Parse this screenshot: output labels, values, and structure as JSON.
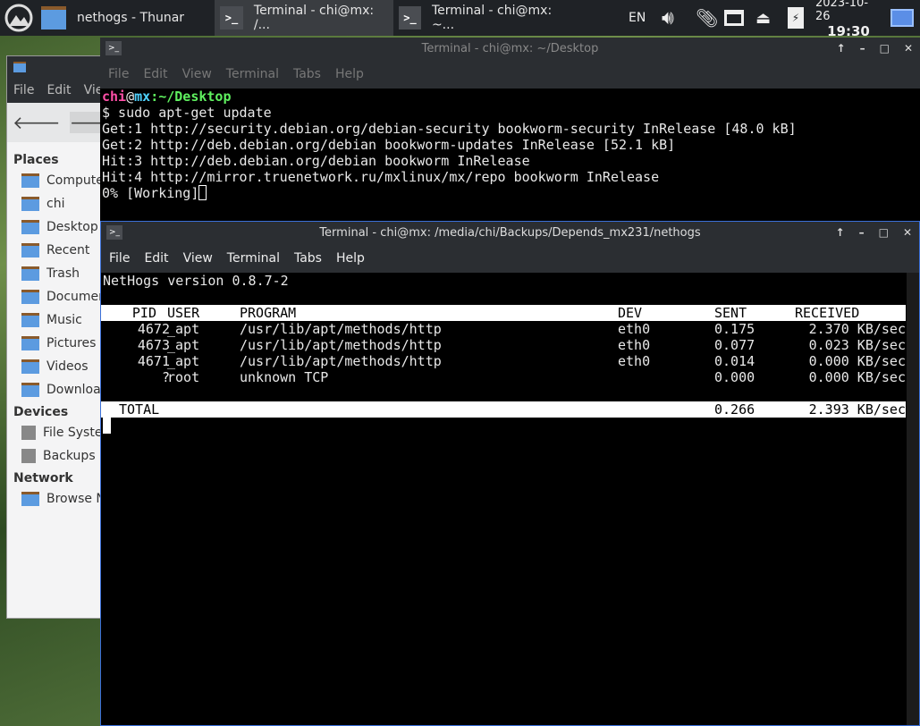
{
  "taskbar": {
    "windows": [
      {
        "label": "nethogs - Thunar"
      },
      {
        "label": "Terminal - chi@mx: /..."
      },
      {
        "label": "Terminal - chi@mx: ~..."
      }
    ],
    "lang": "EN",
    "date": "2023-10-26",
    "time": "19:30"
  },
  "thunar": {
    "menu": [
      "File",
      "Edit",
      "View"
    ],
    "places_header": "Places",
    "places": [
      "Computer",
      "chi",
      "Desktop",
      "Recent",
      "Trash",
      "Documents",
      "Music",
      "Pictures",
      "Videos",
      "Downloads"
    ],
    "devices_header": "Devices",
    "devices": [
      "File System",
      "Backups"
    ],
    "network_header": "Network",
    "network": [
      "Browse Network"
    ]
  },
  "term1": {
    "title": "Terminal - chi@mx: ~/Desktop",
    "menu": [
      "File",
      "Edit",
      "View",
      "Terminal",
      "Tabs",
      "Help"
    ],
    "prompt_user": "chi",
    "prompt_at": "@",
    "prompt_host": "mx",
    "prompt_path": ":~/Desktop",
    "command": "$ sudo apt-get update",
    "lines": [
      "Get:1 http://security.debian.org/debian-security bookworm-security InRelease [48.0 kB]",
      "Get:2 http://deb.debian.org/debian bookworm-updates InRelease [52.1 kB]",
      "Hit:3 http://deb.debian.org/debian bookworm InRelease",
      "Hit:4 http://mirror.truenetwork.ru/mxlinux/mx/repo bookworm InRelease",
      "0% [Working]"
    ]
  },
  "term2": {
    "title": "Terminal - chi@mx: /media/chi/Backups/Depends_mx231/nethogs",
    "menu": [
      "File",
      "Edit",
      "View",
      "Terminal",
      "Tabs",
      "Help"
    ],
    "version": "NetHogs version 0.8.7-2",
    "headers": {
      "pid": "PID",
      "user": "USER",
      "program": "PROGRAM",
      "dev": "DEV",
      "sent": "SENT",
      "received": "RECEIVED"
    },
    "rows": [
      {
        "pid": "4672",
        "user": "_apt",
        "program": "/usr/lib/apt/methods/http",
        "dev": "eth0",
        "sent": "0.175",
        "received": "2.370 KB/sec"
      },
      {
        "pid": "4673",
        "user": "_apt",
        "program": "/usr/lib/apt/methods/http",
        "dev": "eth0",
        "sent": "0.077",
        "received": "0.023 KB/sec"
      },
      {
        "pid": "4671",
        "user": "_apt",
        "program": "/usr/lib/apt/methods/http",
        "dev": "eth0",
        "sent": "0.014",
        "received": "0.000 KB/sec"
      },
      {
        "pid": "?",
        "user": "root",
        "program": "unknown TCP",
        "dev": "",
        "sent": "0.000",
        "received": "0.000 KB/sec"
      }
    ],
    "total": {
      "label": "TOTAL",
      "sent": "0.266",
      "received": "2.393 KB/sec"
    }
  }
}
